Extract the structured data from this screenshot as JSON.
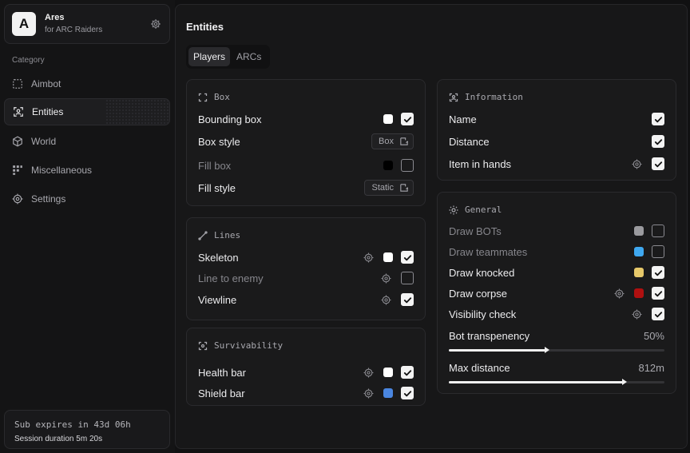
{
  "brand": {
    "logo_letter": "A",
    "name": "Ares",
    "subtitle": "for ARC Raiders",
    "settings_icon": "gear-icon"
  },
  "sidebar": {
    "category_label": "Category",
    "items": [
      {
        "label": "Aimbot",
        "icon": "crosshair-frame-icon",
        "active": false
      },
      {
        "label": "Entities",
        "icon": "entity-target-icon",
        "active": true
      },
      {
        "label": "World",
        "icon": "cube-icon",
        "active": false
      },
      {
        "label": "Miscellaneous",
        "icon": "nodes-icon",
        "active": false
      },
      {
        "label": "Settings",
        "icon": "gear-icon",
        "active": false
      }
    ]
  },
  "footer": {
    "subscription": "Sub expires in 43d 06h",
    "session": "Session duration  5m 20s"
  },
  "main": {
    "title": "Entities",
    "tabs": [
      {
        "label": "Players",
        "active": true
      },
      {
        "label": "ARCs",
        "active": false
      }
    ]
  },
  "box": {
    "title": "Box",
    "bounding_box": {
      "label": "Bounding box",
      "color": "#ffffff",
      "checked": true
    },
    "box_style": {
      "label": "Box style",
      "value": "Box"
    },
    "fill_box": {
      "label": "Fill box",
      "color": "#000000",
      "checked": false
    },
    "fill_style": {
      "label": "Fill style",
      "value": "Static"
    }
  },
  "lines": {
    "title": "Lines",
    "skeleton": {
      "label": "Skeleton",
      "color": "#ffffff",
      "checked": true
    },
    "line_to_enemy": {
      "label": "Line to enemy",
      "checked": false
    },
    "viewline": {
      "label": "Viewline",
      "checked": true
    }
  },
  "survivability": {
    "title": "Survivability",
    "health_bar": {
      "label": "Health bar",
      "color": "#ffffff",
      "checked": true
    },
    "shield_bar": {
      "label": "Shield bar",
      "color": "#4a86e0",
      "checked": true
    }
  },
  "information": {
    "title": "Information",
    "name": {
      "label": "Name",
      "checked": true
    },
    "distance": {
      "label": "Distance",
      "checked": true
    },
    "item_in_hands": {
      "label": "Item in hands",
      "checked": true
    }
  },
  "general": {
    "title": "General",
    "draw_bots": {
      "label": "Draw BOTs",
      "color": "#9a9a9e",
      "checked": false
    },
    "draw_teammates": {
      "label": "Draw teammates",
      "color": "#3fa8f0",
      "checked": false
    },
    "draw_knocked": {
      "label": "Draw knocked",
      "color": "#e6c86a",
      "checked": true
    },
    "draw_corpse": {
      "label": "Draw corpse",
      "color": "#b01010",
      "checked": true
    },
    "visibility_check": {
      "label": "Visibility check",
      "checked": true
    },
    "bot_transparency": {
      "label": "Bot transpenency",
      "value_text": "50%",
      "fraction": 0.45
    },
    "max_distance": {
      "label": "Max distance",
      "value_text": "812m",
      "fraction": 0.81
    }
  }
}
